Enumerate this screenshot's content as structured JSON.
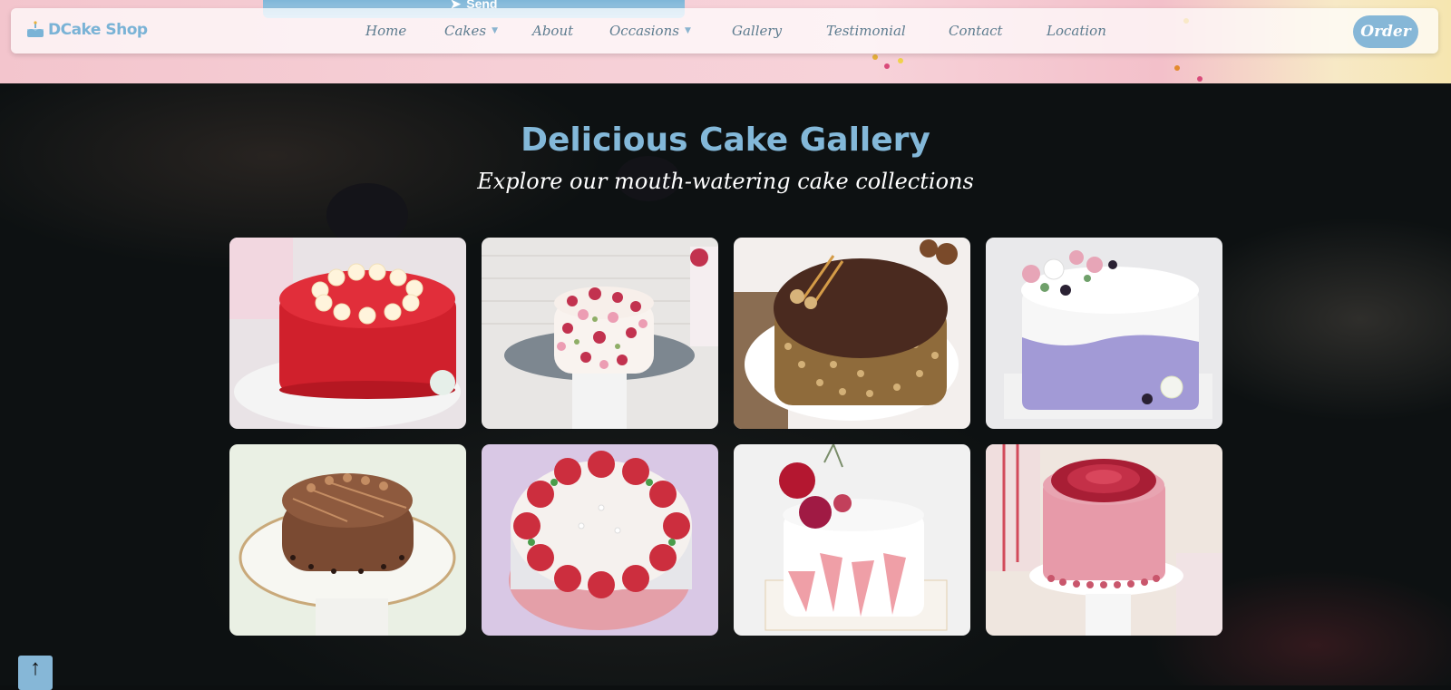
{
  "top_banner": {
    "send_label": "Send"
  },
  "navbar": {
    "brand": "DCake Shop",
    "links": [
      {
        "label": "Home",
        "has_dropdown": false
      },
      {
        "label": "Cakes",
        "has_dropdown": true
      },
      {
        "label": "About",
        "has_dropdown": false
      },
      {
        "label": "Occasions",
        "has_dropdown": true
      },
      {
        "label": "Gallery",
        "has_dropdown": false
      },
      {
        "label": "Testimonial",
        "has_dropdown": false
      },
      {
        "label": "Contact",
        "has_dropdown": false
      },
      {
        "label": "Location",
        "has_dropdown": false
      }
    ],
    "order_label": "Order"
  },
  "gallery": {
    "title": "Delicious Cake Gallery",
    "subtitle": "Explore our mouth-watering cake collections",
    "images": [
      {
        "icon": "red-velvet-cake-image"
      },
      {
        "icon": "rose-floral-cake-image"
      },
      {
        "icon": "chocolate-nut-cake-image"
      },
      {
        "icon": "lavender-floral-cake-image"
      },
      {
        "icon": "chocolate-swirl-cake-image"
      },
      {
        "icon": "red-rose-ring-cake-image"
      },
      {
        "icon": "white-pink-flower-cake-image"
      },
      {
        "icon": "pink-dahlia-cake-image"
      }
    ]
  },
  "back_to_top": {
    "icon": "arrow-up-icon",
    "glyph": "↑"
  },
  "colors": {
    "accent": "#83b8d9",
    "nav_text": "#5d7c8f",
    "banner_pink": "#f3c5cd",
    "background": "#0d1112"
  }
}
